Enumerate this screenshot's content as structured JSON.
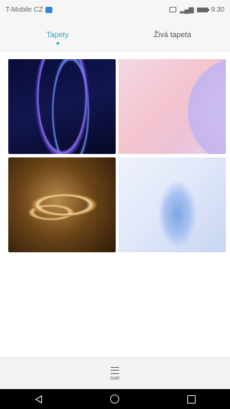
{
  "statusbar": {
    "carrier": "T-Mobile CZ",
    "time": "9:30",
    "icons": [
      "message-icon",
      "sim-icon",
      "signal-icon",
      "battery-icon"
    ]
  },
  "tabs": [
    {
      "label": "Tapety",
      "active": true
    },
    {
      "label": "Živá tapeta",
      "active": false
    }
  ],
  "wallpapers": [
    {
      "name": "dark-blue-curve"
    },
    {
      "name": "pink-lilac-abstract"
    },
    {
      "name": "golden-sculpture"
    },
    {
      "name": "light-blue-fold"
    }
  ],
  "bottombar": {
    "more_label": "Další",
    "more_icon": "menu-icon"
  },
  "navbar": {
    "icons": [
      "back-icon",
      "home-icon",
      "recent-apps-icon"
    ]
  },
  "colors": {
    "accent": "#3ba8c4",
    "navbar": "#000000"
  }
}
